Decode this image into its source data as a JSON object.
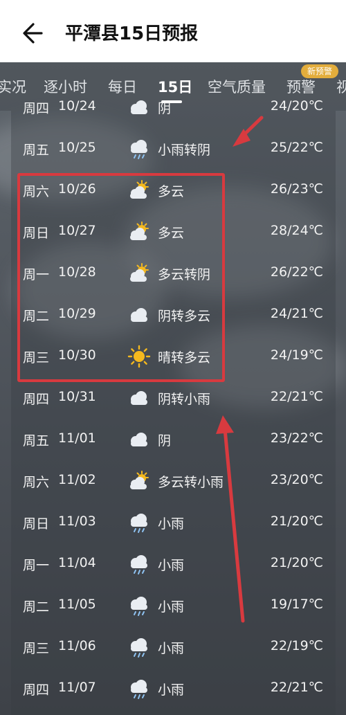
{
  "header": {
    "title": "平潭县15日预报",
    "back_label": "back"
  },
  "tabs": [
    {
      "label": "实况"
    },
    {
      "label": "逐小时"
    },
    {
      "label": "每日"
    },
    {
      "label": "15日"
    },
    {
      "label": "空气质量"
    },
    {
      "label": "预警"
    },
    {
      "label": "视"
    }
  ],
  "active_tab": "15日",
  "badge": "新预警",
  "rows": [
    {
      "weekday": "周四",
      "date": "10/24",
      "icon": "cloudy-icon",
      "condition": "阴",
      "temp": "24/20℃"
    },
    {
      "weekday": "周五",
      "date": "10/25",
      "icon": "rain-icon",
      "condition": "小雨转阴",
      "temp": "25/22℃"
    },
    {
      "weekday": "周六",
      "date": "10/26",
      "icon": "partly-cloudy-icon",
      "condition": "多云",
      "temp": "26/23℃"
    },
    {
      "weekday": "周日",
      "date": "10/27",
      "icon": "partly-cloudy-icon",
      "condition": "多云",
      "temp": "28/24℃"
    },
    {
      "weekday": "周一",
      "date": "10/28",
      "icon": "partly-cloudy-icon",
      "condition": "多云转阴",
      "temp": "26/22℃"
    },
    {
      "weekday": "周二",
      "date": "10/29",
      "icon": "cloudy-icon",
      "condition": "阴转多云",
      "temp": "24/21℃"
    },
    {
      "weekday": "周三",
      "date": "10/30",
      "icon": "sunny-icon",
      "condition": "晴转多云",
      "temp": "24/19℃"
    },
    {
      "weekday": "周四",
      "date": "10/31",
      "icon": "cloudy-icon",
      "condition": "阴转小雨",
      "temp": "22/21℃"
    },
    {
      "weekday": "周五",
      "date": "11/01",
      "icon": "cloudy-icon",
      "condition": "阴",
      "temp": "23/22℃"
    },
    {
      "weekday": "周六",
      "date": "11/02",
      "icon": "partly-cloudy-icon",
      "condition": "多云转小雨",
      "temp": "23/20℃"
    },
    {
      "weekday": "周日",
      "date": "11/03",
      "icon": "rain-icon",
      "condition": "小雨",
      "temp": "21/20℃"
    },
    {
      "weekday": "周一",
      "date": "11/04",
      "icon": "rain-icon",
      "condition": "小雨",
      "temp": "21/20℃"
    },
    {
      "weekday": "周二",
      "date": "11/05",
      "icon": "rain-icon",
      "condition": "小雨",
      "temp": "19/17℃"
    },
    {
      "weekday": "周三",
      "date": "11/06",
      "icon": "rain-icon",
      "condition": "小雨",
      "temp": "22/19℃"
    },
    {
      "weekday": "周四",
      "date": "11/07",
      "icon": "rain-icon",
      "condition": "小雨",
      "temp": "22/21℃"
    }
  ],
  "colors": {
    "annotation_red": "#d83a3f",
    "badge": "#e3ad3c",
    "sun": "#f5b91e",
    "cloud": "#e9edf2"
  }
}
